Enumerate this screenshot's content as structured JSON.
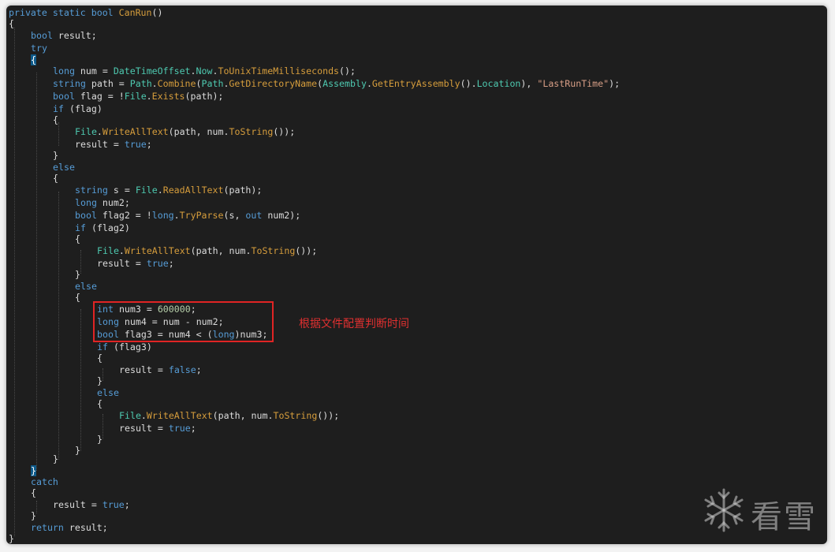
{
  "annotation": "根据文件配置判断时间",
  "watermark": "看雪",
  "code": {
    "method_signature": [
      "private",
      "static",
      "bool",
      "CanRun",
      "()"
    ],
    "keywords": {
      "bool": "bool",
      "long": "long",
      "string": "string",
      "int": "int",
      "try": "try",
      "catch": "catch",
      "if": "if",
      "else": "else",
      "return": "return",
      "true": "true",
      "false": "false",
      "out": "out"
    },
    "classes": {
      "DateTimeOffset": "DateTimeOffset",
      "Now": "Now",
      "Path": "Path",
      "Assembly": "Assembly",
      "File": "File",
      "Location": "Location"
    },
    "methods": {
      "ToUnixTimeMilliseconds": "ToUnixTimeMilliseconds",
      "Combine": "Combine",
      "GetDirectoryName": "GetDirectoryName",
      "GetEntryAssembly": "GetEntryAssembly",
      "Exists": "Exists",
      "WriteAllText": "WriteAllText",
      "ToString": "ToString",
      "ReadAllText": "ReadAllText",
      "TryParse": "TryParse"
    },
    "literals": {
      "last_run_file": "\"LastRunTime\"",
      "interval": "600000"
    },
    "identifiers": {
      "result": "result",
      "num": "num",
      "path": "path",
      "flag": "flag",
      "s": "s",
      "num2": "num2",
      "flag2": "flag2",
      "num3": "num3",
      "num4": "num4",
      "flag3": "flag3"
    }
  }
}
